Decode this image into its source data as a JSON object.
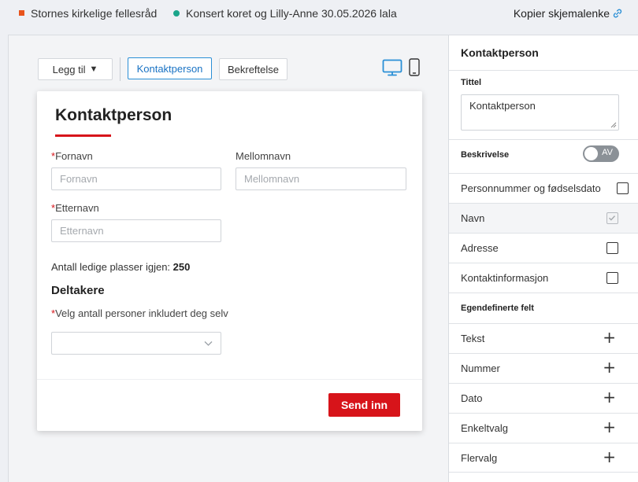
{
  "header": {
    "organization": "Stornes kirkelige fellesråd",
    "event": "Konsert koret og Lilly-Anne 30.05.2026 lala",
    "copy_link": "Kopier skjemalenke",
    "org_color": "#e8541c",
    "event_color": "#1aa58a"
  },
  "toolbar": {
    "add_label": "Legg til",
    "add_caret": "▼",
    "tabs": [
      "Kontaktperson",
      "Bekreftelse"
    ],
    "active_tab": "Kontaktperson",
    "device_icons": [
      "desktop-icon",
      "mobile-icon"
    ]
  },
  "form": {
    "title": "Kontaktperson",
    "required_mark": "*",
    "fields": {
      "fornavn": {
        "label": "Fornavn",
        "placeholder": "Fornavn",
        "required": true
      },
      "mellomnavn": {
        "label": "Mellomnavn",
        "placeholder": "Mellomnavn",
        "required": false
      },
      "etternavn": {
        "label": "Etternavn",
        "placeholder": "Etternavn",
        "required": true
      }
    },
    "seats_label": "Antall ledige plasser igjen:",
    "seats_value": "250",
    "section_title": "Deltakere",
    "participants_label": "Velg antall personer inkludert deg selv",
    "participants_value": "",
    "submit_label": "Send inn",
    "accent_color": "#d7141a"
  },
  "panel": {
    "title": "Kontaktperson",
    "title_field_label": "Tittel",
    "title_field_value": "Kontaktperson",
    "description_label": "Beskrivelse",
    "description_toggle": "AV",
    "options": [
      {
        "label": "Personnummer og fødselsdato",
        "checked": false
      },
      {
        "label": "Navn",
        "checked": true
      },
      {
        "label": "Adresse",
        "checked": false
      },
      {
        "label": "Kontaktinformasjon",
        "checked": false
      }
    ],
    "custom_fields_label": "Egendefinerte felt",
    "custom_fields": [
      "Tekst",
      "Nummer",
      "Dato",
      "Enkeltvalg",
      "Flervalg"
    ],
    "plus_symbol": "+"
  }
}
